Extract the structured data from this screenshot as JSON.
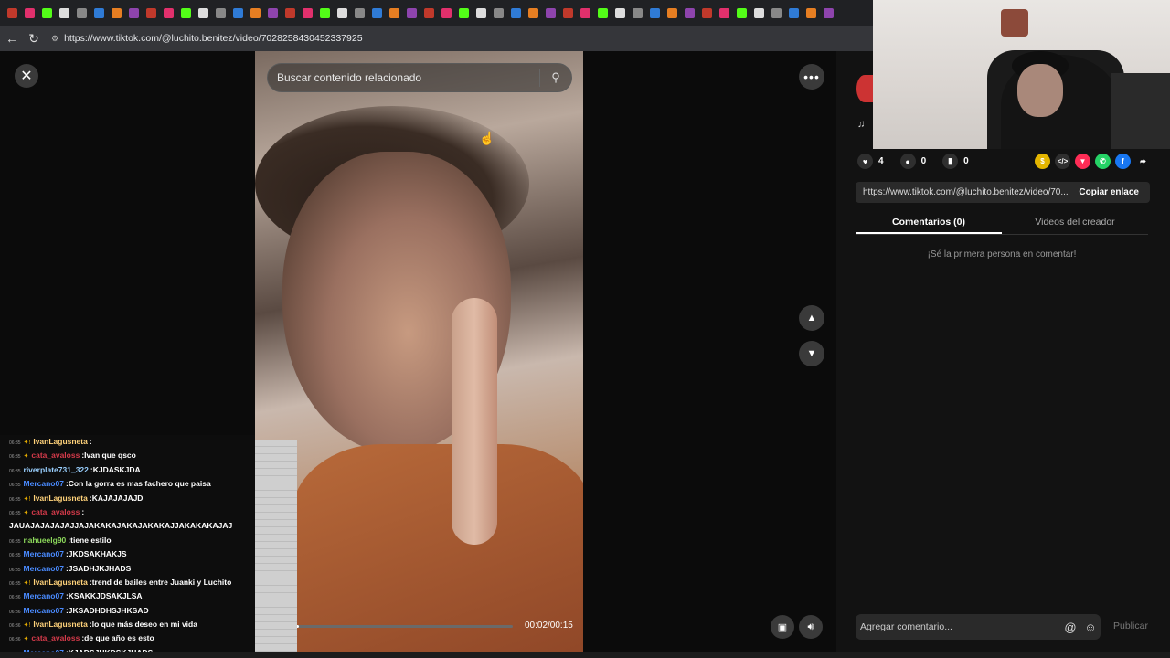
{
  "browser": {
    "url": "https://www.tiktok.com/@luchito.benitez/video/7028258430452337925",
    "tab_icons": [
      "instagram-icon",
      "kick-icon",
      "x-icon",
      "tiktok-icon",
      "google-icon",
      "facebook-icon"
    ]
  },
  "video": {
    "search_placeholder": "Buscar contenido relacionado",
    "time": "00:02/00:15",
    "progress": 0.133
  },
  "chat": [
    {
      "ts": "06:35",
      "user": "IvanLagusneta",
      "color": "#ffd27a",
      "badges": "✦!",
      "msg": ""
    },
    {
      "ts": "06:35",
      "user": "cata_avaloss",
      "color": "#d43a4a",
      "badges": "✦",
      "msg": "Ivan que qsco"
    },
    {
      "ts": "06:35",
      "user": "riverplate731_322",
      "color": "#9ad0ff",
      "badges": "",
      "msg": "KJDASKJDA"
    },
    {
      "ts": "06:35",
      "user": "Mercano07",
      "color": "#4a8bff",
      "badges": "",
      "msg": "Con la gorra es mas fachero que paisa"
    },
    {
      "ts": "06:35",
      "user": "IvanLagusneta",
      "color": "#ffd27a",
      "badges": "✦!",
      "msg": "KAJAJAJAJD"
    },
    {
      "ts": "06:35",
      "user": "cata_avaloss",
      "color": "#d43a4a",
      "badges": "✦",
      "msg": ""
    },
    {
      "ts": "",
      "user": "",
      "color": "#fff",
      "badges": "",
      "msg": "JAUAJAJAJAJAJJAJAKAKAJAKAJAKAKAJJAKAKAKAJAJ"
    },
    {
      "ts": "06:35",
      "user": "nahueelg90",
      "color": "#8bd65a",
      "badges": "",
      "msg": "tiene estilo"
    },
    {
      "ts": "06:35",
      "user": "Mercano07",
      "color": "#4a8bff",
      "badges": "",
      "msg": "JKDSAKHAKJS"
    },
    {
      "ts": "06:35",
      "user": "Mercano07",
      "color": "#4a8bff",
      "badges": "",
      "msg": "JSADHJKJHADS"
    },
    {
      "ts": "06:35",
      "user": "IvanLagusneta",
      "color": "#ffd27a",
      "badges": "✦!",
      "msg": "trend de bailes entre Juanki y Luchito"
    },
    {
      "ts": "06:36",
      "user": "Mercano07",
      "color": "#4a8bff",
      "badges": "",
      "msg": "KSAKKJDSAKJLSA"
    },
    {
      "ts": "06:36",
      "user": "Mercano07",
      "color": "#4a8bff",
      "badges": "",
      "msg": "JKSADHDHSJHKSAD"
    },
    {
      "ts": "06:36",
      "user": "IvanLagusneta",
      "color": "#ffd27a",
      "badges": "✦!",
      "msg": "lo que más deseo en mi vida"
    },
    {
      "ts": "06:36",
      "user": "cata_avaloss",
      "color": "#d43a4a",
      "badges": "✦",
      "msg": "de que año es esto"
    },
    {
      "ts": "06:36",
      "user": "Mercano07",
      "color": "#4a8bff",
      "badges": "",
      "msg": "KJADSJHKDSKJHADS"
    }
  ],
  "panel": {
    "likes": "4",
    "comments": "0",
    "saves": "0",
    "link": "https://www.tiktok.com/@luchito.benitez/video/70...",
    "copy_label": "Copiar enlace",
    "tab_comments": "Comentarios (0)",
    "tab_creator": "Videos del creador",
    "empty_text": "¡Sé la primera persona en comentar!",
    "comment_placeholder": "Agregar comentario...",
    "publish_label": "Publicar"
  }
}
